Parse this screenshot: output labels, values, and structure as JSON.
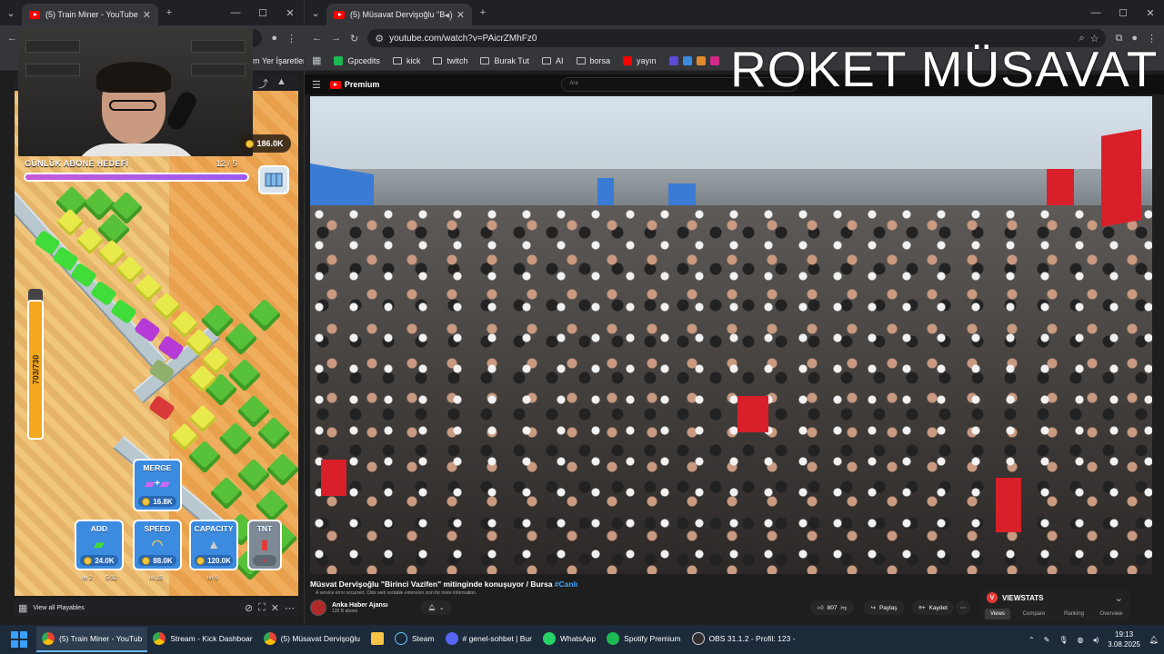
{
  "left_window": {
    "tab_title": "(5) Train Miner - YouTube",
    "bookmarks_tail": "m Yer İşaretleri",
    "game": {
      "coin_total": "186.0K",
      "goal_label": "GÜNLÜK ABONE HEDEFİ",
      "goal_count": "12 / 5",
      "goal_fill_fraction": 1.0,
      "progress_text": "703/730",
      "merge": {
        "label": "MERGE",
        "price": "16.8K"
      },
      "upgrades": [
        {
          "label": "ADD",
          "price": "24.0K",
          "level": "lvl 2",
          "extra": "5/32"
        },
        {
          "label": "SPEED",
          "price": "88.0K",
          "level": "lvl 15",
          "extra": ""
        },
        {
          "label": "CAPACITY",
          "price": "120.0K",
          "level": "lvl 9",
          "extra": ""
        },
        {
          "label": "TNT",
          "price": "",
          "level": "",
          "extra": ""
        }
      ]
    },
    "footer": {
      "view_all": "View all Playables"
    }
  },
  "right_window": {
    "tab_title": "(5) Müsavat Dervişoğlu \"Bir...",
    "url": "youtube.com/watch?v=PAicrZMhFz0",
    "bookmarks": [
      "Gpcedits",
      "kick",
      "twitch",
      "Burak Tut",
      "AI",
      "borsa",
      "yayın"
    ],
    "overlay_title": "ROKET MÜSAVAT",
    "youtube": {
      "logo": "Premium",
      "search_placeholder": "Ara",
      "video_title": "Müsvat Dervişoğlu \"Birinci Vazifen\" mitinginde konuşuyor / Bursa",
      "video_tag": "#Canlı",
      "warning": "A service error occurred. Click web sortable extension icon for more information.",
      "channel_name": "Anka Haber Ajansı",
      "channel_subs": "126 B abone",
      "likes": "807",
      "share_label": "Paylaş",
      "save_label": "Kaydet"
    },
    "viewstats": {
      "title": "VIEWSTATS",
      "tabs": [
        "Views",
        "Compare",
        "Ranking",
        "Overview"
      ],
      "active_tab": "Views"
    }
  },
  "taskbar": {
    "items": [
      {
        "label": "(5) Train Miner - YouTub",
        "icon": "chrome-icon",
        "active": true
      },
      {
        "label": "Stream - Kick Dashboar",
        "icon": "chrome-icon",
        "active": false
      },
      {
        "label": "(5) Müsavat Dervişoğlu",
        "icon": "chrome-icon",
        "active": false
      },
      {
        "label": "",
        "icon": "folder-icon",
        "active": false
      },
      {
        "label": "Steam",
        "icon": "steam-icon",
        "active": false
      },
      {
        "label": "# genel-sohbet | Bur",
        "icon": "discord-icon",
        "active": false
      },
      {
        "label": "WhatsApp",
        "icon": "whatsapp-icon",
        "active": false
      },
      {
        "label": "Spotify Premium",
        "icon": "spotify-icon",
        "active": false
      },
      {
        "label": "OBS 31.1.2 - Profil: 123 -",
        "icon": "obs-icon",
        "active": false
      }
    ],
    "time": "19:13",
    "date": "3.08.2025"
  },
  "colors": {
    "youtube_red": "#ff0000",
    "taskbar": "#1c2a3a",
    "flag_red": "#d9202a"
  }
}
